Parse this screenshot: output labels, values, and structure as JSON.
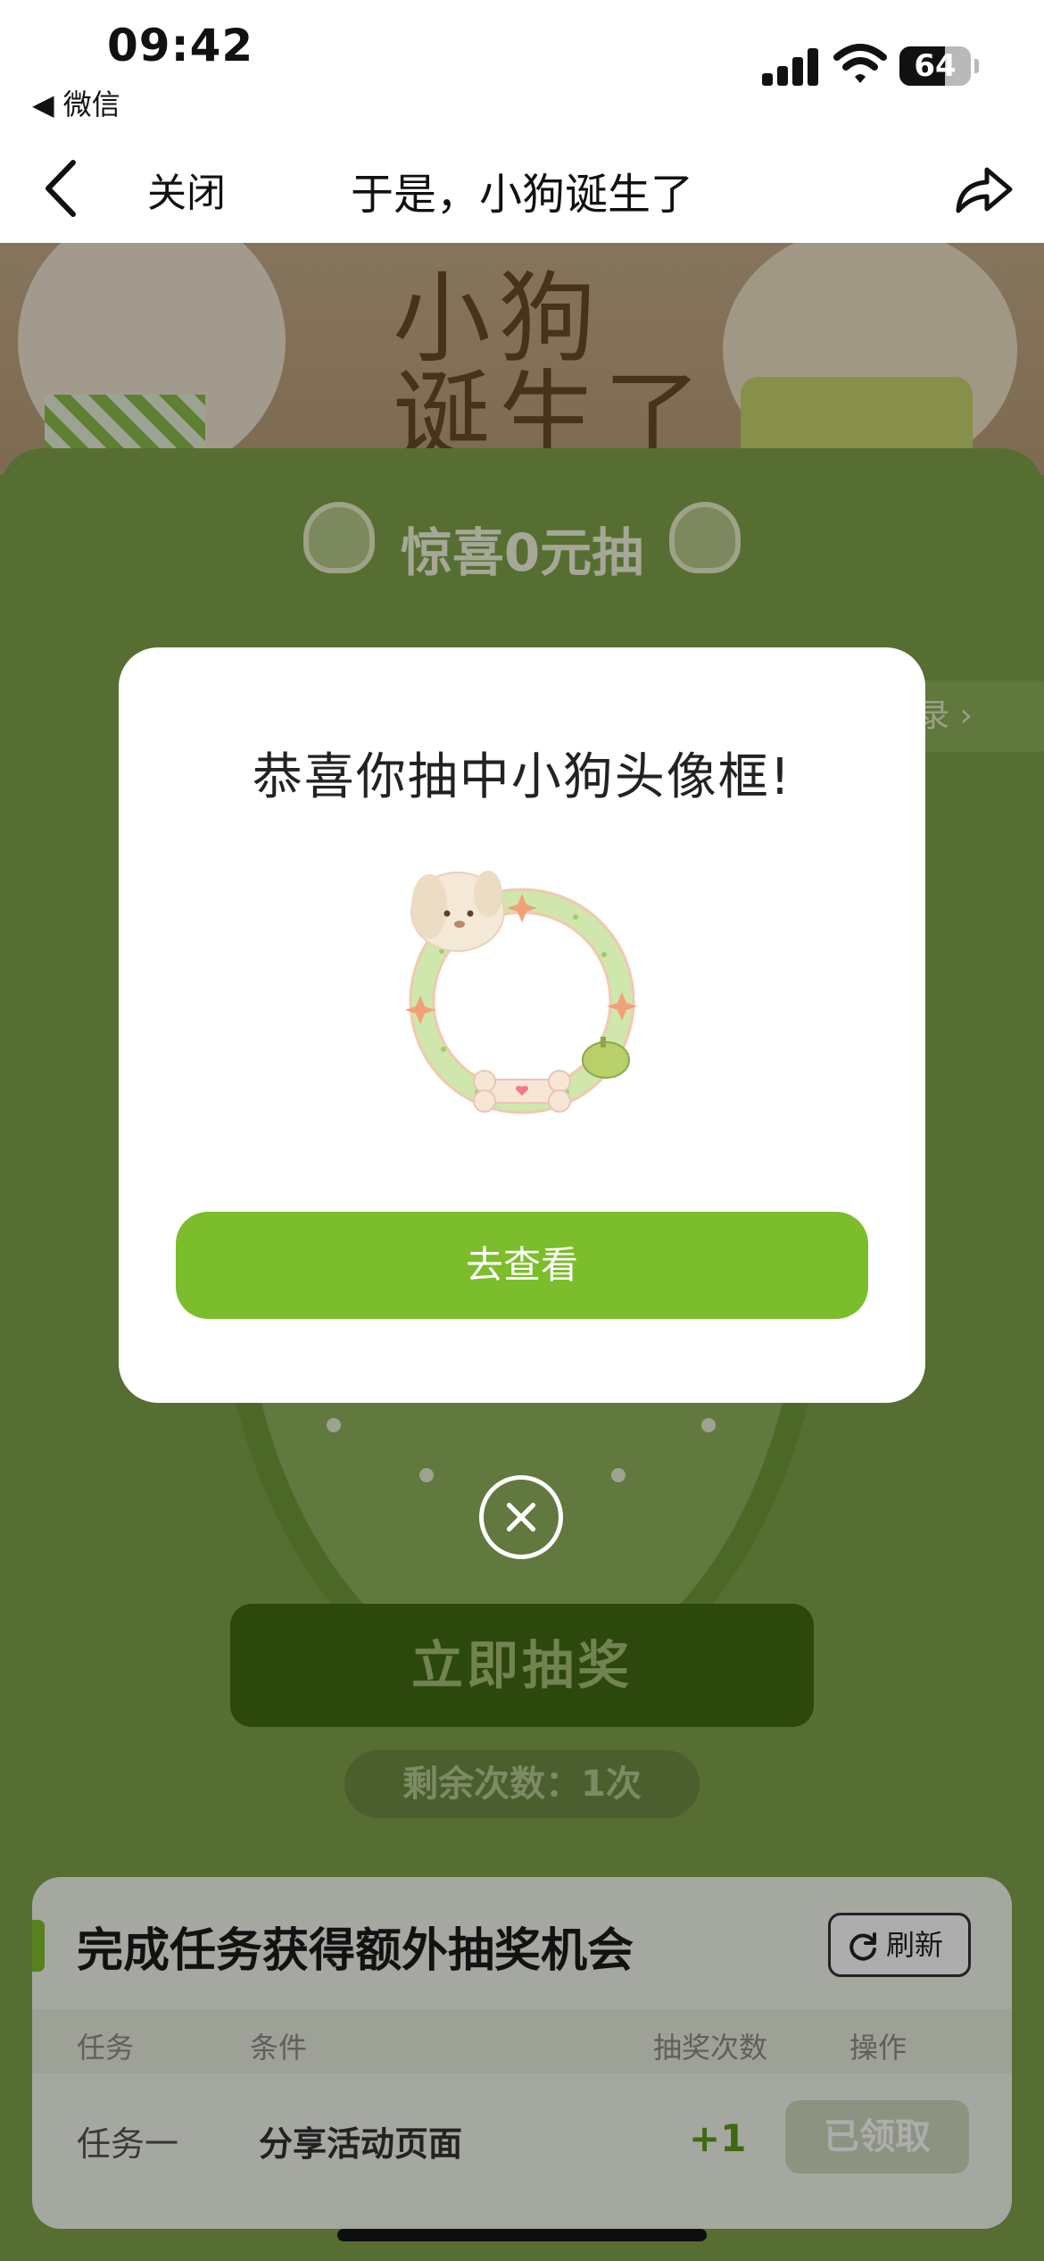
{
  "status_bar": {
    "time": "09:42",
    "back_app_label": "◀ 微信",
    "battery_percent": "64",
    "battery_level": 0.64
  },
  "nav": {
    "close_label": "关闭",
    "title": "于是，小狗诞生了"
  },
  "banner": {
    "title_text": "小狗\n诞生了"
  },
  "panel": {
    "title": "惊喜0元抽",
    "records_label": "录 ›"
  },
  "actions": {
    "draw_label": "立即抽奖",
    "remaining_label": "剩余次数：1次"
  },
  "tasks": {
    "title": "完成任务获得额外抽奖机会",
    "refresh_label": "刷新",
    "columns": [
      "任务",
      "条件",
      "抽奖次数",
      "操作"
    ],
    "rows": [
      {
        "name": "任务一",
        "condition": "分享活动页面",
        "count": "+1",
        "action": "已领取"
      }
    ]
  },
  "modal": {
    "title": "恭喜你抽中小狗头像框!",
    "button_label": "去查看"
  },
  "colors": {
    "accent_green": "#7cbd2b",
    "page_green": "#7fa24a",
    "dark_green": "#426b14"
  }
}
